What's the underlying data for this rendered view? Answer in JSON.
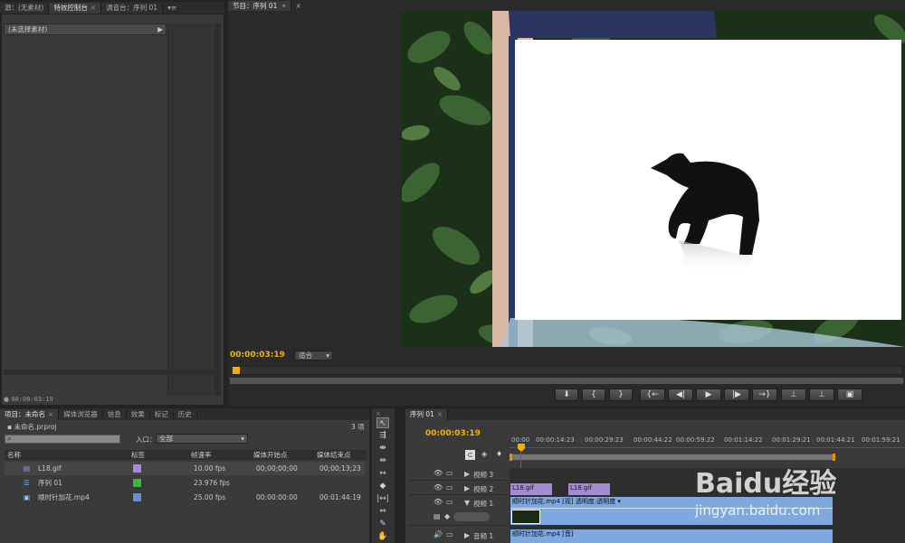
{
  "source_panel": {
    "tabs": [
      {
        "label": "源：(无素材)",
        "active": false
      },
      {
        "label": "特效控制台",
        "active": true
      },
      {
        "label": "调音台：序列 01",
        "active": false
      }
    ],
    "no_clip_label": "(未选择素材)",
    "timecode": "00:00:03:19"
  },
  "program_panel": {
    "tab_label": "节目：序列 01",
    "timecode": "00:00:03:19",
    "fit_label": "适合"
  },
  "project_panel": {
    "tabs": [
      {
        "label": "项目：未命名",
        "active": true
      },
      {
        "label": "媒体浏览器",
        "active": false
      },
      {
        "label": "信息",
        "active": false
      },
      {
        "label": "效果",
        "active": false
      },
      {
        "label": "标记",
        "active": false
      },
      {
        "label": "历史",
        "active": false
      }
    ],
    "project_file": "未命名.prproj",
    "item_count": "3 项",
    "in_label": "入口：",
    "in_value": "全部",
    "search_placeholder": "",
    "columns": [
      "名称",
      "标签",
      "帧速率",
      "媒体开始点",
      "媒体结束点"
    ],
    "items": [
      {
        "name": "L18.gif",
        "label_color": "#a58ad6",
        "fps": "10.00 fps",
        "start": "00;00;00;00",
        "end": "00;00;13;23",
        "icon": "still-image-icon"
      },
      {
        "name": "序列 01",
        "label_color": "#3cb64a",
        "fps": "23.976 fps",
        "start": "",
        "end": "",
        "icon": "sequence-icon"
      },
      {
        "name": "顺时针加花.mp4",
        "label_color": "#6b8fc7",
        "fps": "25.00 fps",
        "start": "00:00:00:00",
        "end": "00:01:44:19",
        "icon": "video-clip-icon"
      }
    ]
  },
  "timeline": {
    "tab_label": "序列 01",
    "timecode": "00:00:03:19",
    "ruler": [
      "00:00",
      "00:00:14:23",
      "00:00:29:23",
      "00:00:44:22",
      "00:00:59:22",
      "00:01:14:22",
      "00:01:29:21",
      "00:01:44:21",
      "00:01:59:21"
    ],
    "tracks": [
      {
        "name": "视频 3",
        "clips": []
      },
      {
        "name": "视频 2",
        "clips": [
          {
            "label": "L18.gif",
            "color": "#a58ad6"
          },
          {
            "label": "L18.gif",
            "color": "#a58ad6"
          }
        ]
      },
      {
        "name": "视频 1",
        "clips": [
          {
            "label": "顺时针加花.mp4 [视]  透明度:透明度 ▾",
            "color": "#7fa8e0"
          }
        ]
      },
      {
        "name": "音频 1",
        "clips": [
          {
            "label": "顺时针加花.mp4 [音]",
            "color": "#7fa8e0"
          }
        ]
      }
    ]
  },
  "watermark": {
    "brand": "Baidu经验",
    "url": "jingyan.baidu.com"
  }
}
